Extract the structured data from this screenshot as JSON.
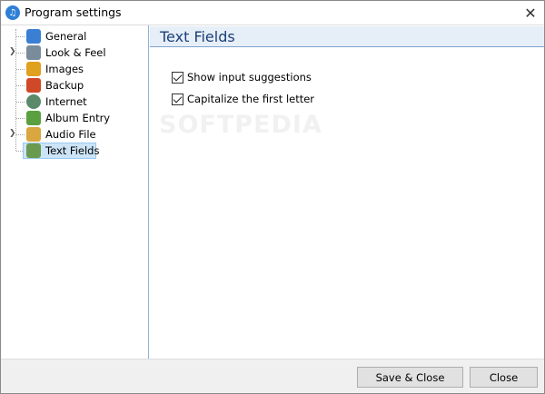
{
  "window": {
    "title": "Program settings",
    "close_glyph": "✕",
    "app_icon": "music-note-icon"
  },
  "sidebar": {
    "items": [
      {
        "label": "General",
        "icon": "gear-icon",
        "color": "#3b7fd4",
        "expandable": false,
        "selected": false
      },
      {
        "label": "Look & Feel",
        "icon": "palette-icon",
        "color": "#7a8c9c",
        "expandable": true,
        "selected": false
      },
      {
        "label": "Images",
        "icon": "images-icon",
        "color": "#e0a020",
        "expandable": false,
        "selected": false
      },
      {
        "label": "Backup",
        "icon": "backup-icon",
        "color": "#d04828",
        "expandable": false,
        "selected": false
      },
      {
        "label": "Internet",
        "icon": "globe-icon",
        "color": "#5a8a6a",
        "expandable": false,
        "selected": false
      },
      {
        "label": "Album Entry",
        "icon": "album-entry-icon",
        "color": "#5aa040",
        "expandable": false,
        "selected": false
      },
      {
        "label": "Audio File",
        "icon": "audio-file-icon",
        "color": "#d9a640",
        "expandable": true,
        "selected": false
      },
      {
        "label": "Text Fields",
        "icon": "text-fields-icon",
        "color": "#6a9a50",
        "expandable": false,
        "selected": true
      }
    ]
  },
  "content": {
    "title": "Text Fields",
    "options": [
      {
        "label": "Show input suggestions",
        "checked": true
      },
      {
        "label": "Capitalize the first letter",
        "checked": true
      }
    ]
  },
  "watermark": "SOFTPEDIA",
  "footer": {
    "save_close_label": "Save & Close",
    "close_label": "Close"
  },
  "colors": {
    "header_title": "#1c3f7a",
    "header_bg": "#e6eef7",
    "selection_bg": "#cce4f7"
  }
}
